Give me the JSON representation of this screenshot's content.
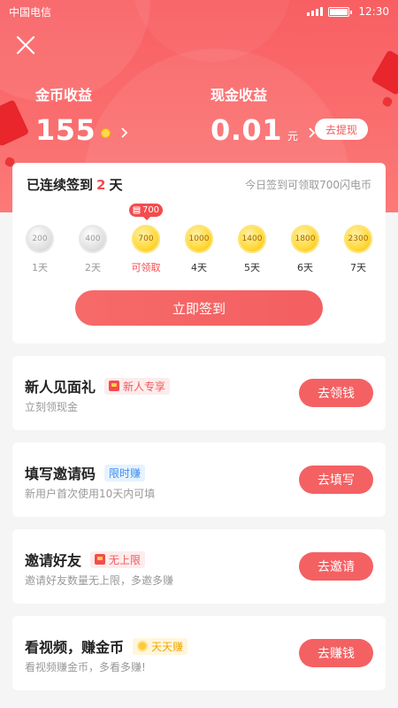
{
  "status_bar": {
    "carrier": "中国电信",
    "time": "12:30"
  },
  "header": {
    "coin_label": "金币收益",
    "coin_value": "155",
    "cash_label": "现金收益",
    "cash_value": "0.01",
    "cash_unit": "元",
    "withdraw_label": "去提现"
  },
  "signin": {
    "title_prefix": "已连续签到",
    "streak_days": "2",
    "title_suffix": "天",
    "tip": "今日签到可领取700闪电币",
    "bubble": "700",
    "button_label": "立即签到",
    "days": [
      {
        "amount": "200",
        "label": "1天",
        "state": "claimed"
      },
      {
        "amount": "400",
        "label": "2天",
        "state": "claimed"
      },
      {
        "amount": "700",
        "label": "可领取",
        "state": "today"
      },
      {
        "amount": "1000",
        "label": "4天",
        "state": "future"
      },
      {
        "amount": "1400",
        "label": "5天",
        "state": "future"
      },
      {
        "amount": "1800",
        "label": "6天",
        "state": "future"
      },
      {
        "amount": "2300",
        "label": "7天",
        "state": "future"
      }
    ]
  },
  "tasks": [
    {
      "title": "新人见面礼",
      "tag": "新人专享",
      "subtitle": "立刻领现金",
      "button": "去领钱"
    },
    {
      "title": "填写邀请码",
      "tag": "限时赚",
      "subtitle": "新用户首次使用10天内可填",
      "button": "去填写"
    },
    {
      "title": "邀请好友",
      "tag": "无上限",
      "subtitle": "邀请好友数量无上限，多邀多赚",
      "button": "去邀请"
    },
    {
      "title": "看视频，赚金币",
      "tag": "天天赚",
      "subtitle": "看视频赚金币，多看多赚!",
      "button": "去赚钱"
    }
  ],
  "colors": {
    "primary": "#f46163",
    "accent": "#f44c4f",
    "gold": "#ffd93a"
  }
}
